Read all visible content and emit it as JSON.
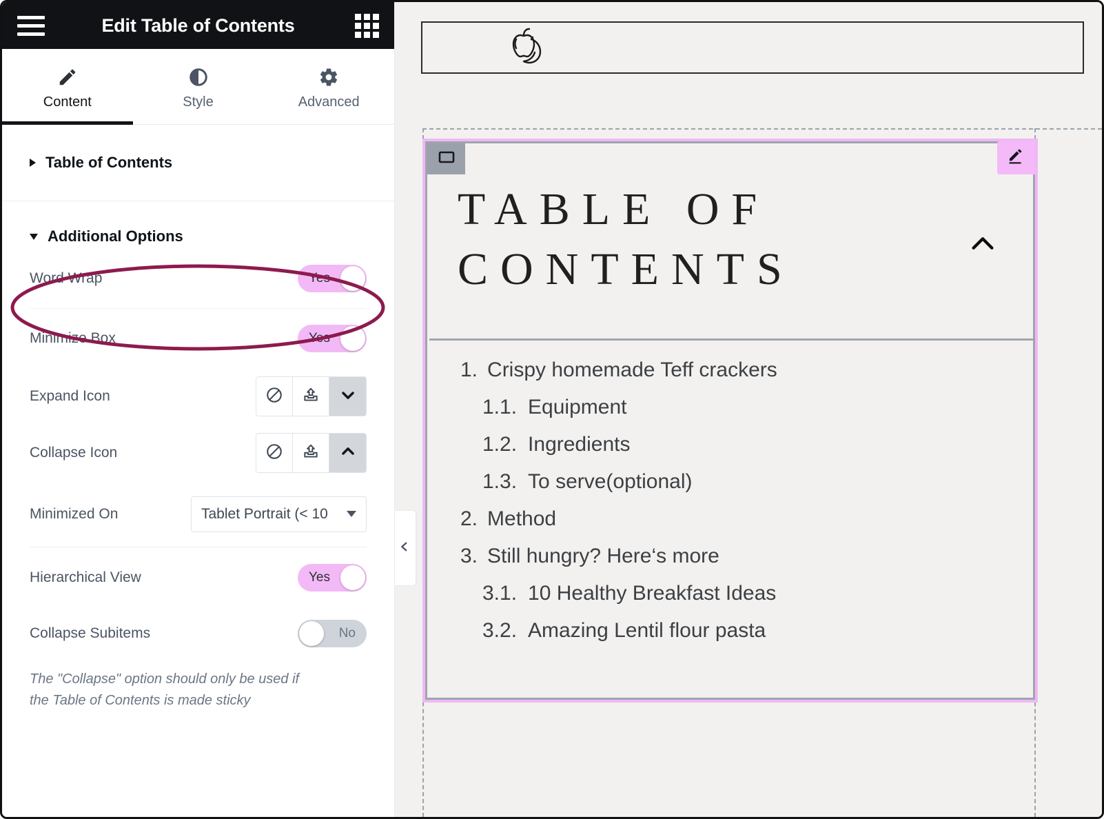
{
  "panel": {
    "header": {
      "title": "Edit Table of Contents",
      "menu_icon": "hamburger-icon",
      "apps_icon": "grid-apps-icon"
    },
    "tabs": [
      {
        "label": "Content",
        "icon": "pencil-icon",
        "active": true
      },
      {
        "label": "Style",
        "icon": "contrast-icon",
        "active": false
      },
      {
        "label": "Advanced",
        "icon": "gear-icon",
        "active": false
      }
    ],
    "sections": [
      {
        "title": "Table of Contents",
        "expanded": false
      },
      {
        "title": "Additional Options",
        "expanded": true
      }
    ],
    "options": {
      "word_wrap": {
        "label": "Word Wrap",
        "value": "Yes",
        "state": "on"
      },
      "minimize_box": {
        "label": "Minimize Box",
        "value": "Yes",
        "state": "on"
      },
      "expand_icon": {
        "label": "Expand Icon",
        "choices": [
          "none-icon",
          "upload-icon",
          "chevron-down-icon"
        ],
        "selected": 2
      },
      "collapse_icon": {
        "label": "Collapse Icon",
        "choices": [
          "none-icon",
          "upload-icon",
          "chevron-up-icon"
        ],
        "selected": 2
      },
      "minimized_on": {
        "label": "Minimized On",
        "value": "Tablet Portrait (< 10"
      },
      "hierarchical_view": {
        "label": "Hierarchical View",
        "value": "Yes",
        "state": "on"
      },
      "collapse_subitems": {
        "label": "Collapse Subitems",
        "value": "No",
        "state": "off"
      }
    },
    "note": "The \"Collapse\" option should only be used if the Table of Contents is made sticky"
  },
  "annotation": {
    "shape": "ellipse",
    "target": "Word Wrap",
    "color": "#8d1b4e"
  },
  "preview": {
    "logo": "apple-banana-logo",
    "collapse_panel_icon": "chevron-left-icon",
    "widget": {
      "handle_icon": "container-icon",
      "edit_icon": "pencil-edit-icon",
      "collapse_icon": "chevron-up-icon",
      "title": "TABLE OF CONTENTS",
      "items": [
        {
          "num": "1.",
          "text": "Crispy homemade Teff crackers",
          "level": 1
        },
        {
          "num": "1.1.",
          "text": "Equipment",
          "level": 2
        },
        {
          "num": "1.2.",
          "text": "Ingredients",
          "level": 2
        },
        {
          "num": "1.3.",
          "text": "To serve(optional)",
          "level": 2
        },
        {
          "num": "2.",
          "text": "Method",
          "level": 1
        },
        {
          "num": "3.",
          "text": "Still hungry? Here‘s more",
          "level": 1
        },
        {
          "num": "3.1.",
          "text": "10 Healthy Breakfast Ideas",
          "level": 2
        },
        {
          "num": "3.2.",
          "text": "Amazing Lentil flour pasta",
          "level": 2
        }
      ]
    }
  },
  "colors": {
    "accent_pink": "#f3b9f6",
    "widget_border": "#efb8f5",
    "annotation": "#8d1b4e",
    "header_bg": "#111215",
    "preview_bg": "#f2f1ef"
  }
}
